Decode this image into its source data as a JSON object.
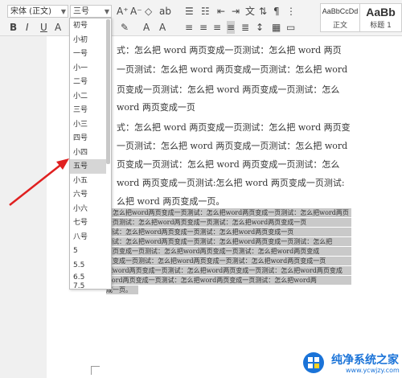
{
  "toolbar": {
    "font_name": "宋体 (正文)",
    "font_size": "三号",
    "size_buttons": [
      "A⁺",
      "A⁻"
    ],
    "format_buttons": [
      "B",
      "I",
      "U"
    ],
    "style_gallery": [
      {
        "sample": "AaBbCcDd",
        "label": "正文"
      },
      {
        "sample": "AaBb",
        "label": "标题 1"
      }
    ]
  },
  "font_size_menu": {
    "items": [
      "初号",
      "小初",
      "一号",
      "小一",
      "二号",
      "小二",
      "三号",
      "小三",
      "四号",
      "小四",
      "五号",
      "小五",
      "六号",
      "小六",
      "七号",
      "八号",
      "5",
      "5.5",
      "6.5",
      "7.5"
    ],
    "highlighted": "五号"
  },
  "document": {
    "lines": [
      "式：怎么把 word 两页变成一页测试：怎么把 word 两页",
      "一页测试：怎么把 word 两页变成一页测试：怎么把 word",
      "页变成一页测试：怎么把 word 两页变成一页测试：怎么",
      "word 两页变成一页",
      "式：怎么把 word 两页变成一页测试：怎么把 word 两页变",
      "一页测试：怎么把 word 两页变成一页测试：怎么把 word",
      "页变成一页测试：怎么把 word 两页变成一页测试：怎么",
      "word 两页变成一页测试:怎么把 word 两页变成一页测试:",
      "么把 word 两页变成一页。"
    ],
    "selected_lines": [
      "：怎么把word两页变成一页测试：怎么把word两页变成一页测试：怎么把word两页",
      "一页测试：怎么把word两页变成一页测试：怎么把word两页变成一页",
      "测试：怎么把word两页变成一页测试：怎么把word两页变成一页",
      "测试：怎么把word两页变成一页测试：怎么把word两页变成一页测试：怎么把",
      "两页变成一页测试：怎么把word两页变成一页测试：怎么把word两页变成",
      "页变成一页测试：怎么把word两页变成一页测试：怎么把word两页变成一页",
      "把word两页变成一页测试：怎么把word两页变成一页测试：怎么把word两页变成",
      "word两页变成一页测试：怎么把word两页变成一页测试：怎么把word两",
      "成一页。"
    ]
  },
  "watermark": {
    "title": "纯净系统之家",
    "url": "www.ycwjzy.com"
  },
  "colors": {
    "arrow": "#e02020",
    "selection": "#c9c9c9",
    "menu_highlight": "#d6d6d6",
    "watermark": "#1a73d8"
  }
}
